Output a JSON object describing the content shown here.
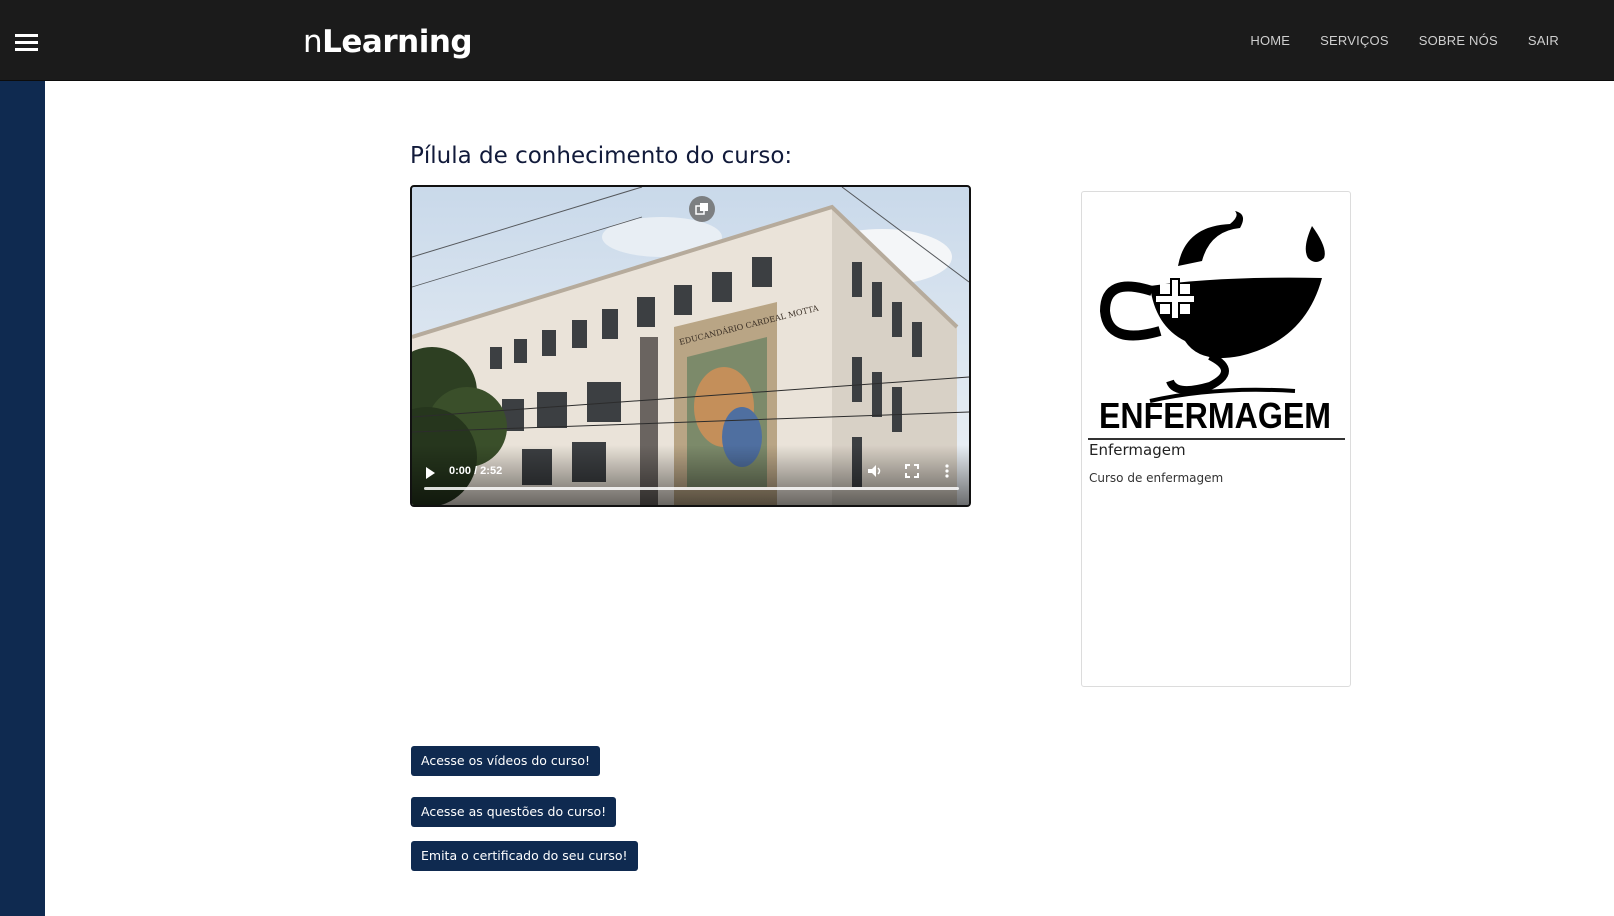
{
  "header": {
    "brand_prefix": "n",
    "brand_main": "Learning",
    "nav": [
      {
        "label": "HOME"
      },
      {
        "label": "SERVIÇOS"
      },
      {
        "label": "SOBRE NÓS"
      },
      {
        "label": "SAIR"
      }
    ]
  },
  "main": {
    "section_title": "Pílula de conhecimento do curso:",
    "video": {
      "time_display": "0:00 / 2:52",
      "building_sign": "EDUCANDÁRIO CARDEAL MOTTA",
      "progress": 0
    },
    "buttons": {
      "videos": "Acesse os vídeos do curso!",
      "questions": "Acesse as questões do curso!",
      "certificate": "Emita o certificado do seu curso!"
    }
  },
  "course_card": {
    "logo_text": "ENFERMAGEM",
    "title": "Enfermagem",
    "description": "Curso de enfermagem"
  },
  "colors": {
    "topbar": "#1b1b1b",
    "sidebar": "#0f2a50",
    "button": "#0f2a50"
  }
}
